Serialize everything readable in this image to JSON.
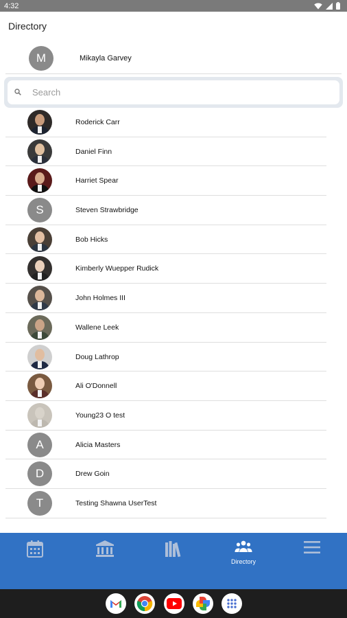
{
  "status_bar": {
    "time": "4:32"
  },
  "header": {
    "title": "Directory"
  },
  "current_user": {
    "initial": "M",
    "name": "Mikayla Garvey"
  },
  "search": {
    "placeholder": "Search",
    "value": ""
  },
  "directory": [
    {
      "name": "Roderick Carr",
      "avatar": "photo"
    },
    {
      "name": "Daniel Finn",
      "avatar": "photo"
    },
    {
      "name": "Harriet Spear",
      "avatar": "photo"
    },
    {
      "name": "Steven Strawbridge",
      "avatar": "initial",
      "initial": "S"
    },
    {
      "name": "Bob Hicks",
      "avatar": "photo"
    },
    {
      "name": "Kimberly Wuepper Rudick",
      "avatar": "photo"
    },
    {
      "name": "John Holmes III",
      "avatar": "photo"
    },
    {
      "name": "Wallene Leek",
      "avatar": "photo"
    },
    {
      "name": "Doug Lathrop",
      "avatar": "photo"
    },
    {
      "name": "Ali O'Donnell",
      "avatar": "photo"
    },
    {
      "name": "Young23 O test",
      "avatar": "photo"
    },
    {
      "name": "Alicia Masters",
      "avatar": "initial",
      "initial": "A"
    },
    {
      "name": "Drew Goin",
      "avatar": "initial",
      "initial": "D"
    },
    {
      "name": "Testing Shawna UserTest",
      "avatar": "initial",
      "initial": "T"
    }
  ],
  "bottom_nav": {
    "items": [
      {
        "icon": "calendar-icon",
        "label": ""
      },
      {
        "icon": "bank-icon",
        "label": ""
      },
      {
        "icon": "library-icon",
        "label": ""
      },
      {
        "icon": "people-icon",
        "label": "Directory",
        "active": true
      },
      {
        "icon": "menu-icon",
        "label": ""
      }
    ]
  },
  "dock": {
    "apps": [
      "gmail-icon",
      "chrome-icon",
      "youtube-icon",
      "photos-icon",
      "app-drawer-icon"
    ]
  },
  "colors": {
    "nav_background": "#3172c4",
    "nav_icon_inactive": "#aebfd9",
    "avatar_gray": "#8a8a8a"
  }
}
